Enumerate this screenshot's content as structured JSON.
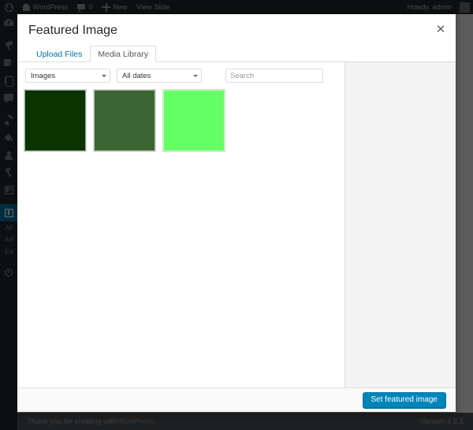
{
  "adminbar": {
    "logo_icon": "wordpress-logo-icon",
    "site_name": "WordPress",
    "site_icon": "home-icon",
    "comments_icon": "comment-bubble-icon",
    "comments_count": "0",
    "new_icon": "plus-icon",
    "new_label": "New",
    "view_label": "View Slide",
    "howdy": "Howdy, admin"
  },
  "adminmenu": {
    "items": [
      {
        "name": "dashboard",
        "icon": "dashboard-icon"
      },
      {
        "name": "posts",
        "icon": "pushpin-icon"
      },
      {
        "name": "media",
        "icon": "media-photo-icon"
      },
      {
        "name": "pages",
        "icon": "pages-document-icon"
      },
      {
        "name": "comments",
        "icon": "comment-bubble-icon"
      },
      {
        "name": "appearance",
        "icon": "paintbrush-icon"
      },
      {
        "name": "plugins",
        "icon": "plug-icon"
      },
      {
        "name": "users",
        "icon": "user-icon"
      },
      {
        "name": "tools",
        "icon": "wrench-icon"
      },
      {
        "name": "settings",
        "icon": "settings-sliders-icon"
      }
    ],
    "current": {
      "name": "slides",
      "icon": "slides-icon"
    },
    "submenu": [
      {
        "label": "All"
      },
      {
        "label": "Ad"
      },
      {
        "label": "Ea"
      }
    ],
    "collapse": {
      "label": "",
      "icon": "collapse-arrow-icon"
    }
  },
  "modal": {
    "title": "Featured Image",
    "close_icon": "close-icon",
    "tabs": [
      {
        "label": "Upload Files",
        "active": false
      },
      {
        "label": "Media Library",
        "active": true
      }
    ],
    "toolbar": {
      "type_filter": {
        "value": "Images",
        "caret_icon": "chevron-down-icon"
      },
      "date_filter": {
        "value": "All dates",
        "caret_icon": "chevron-down-icon"
      },
      "search": {
        "value": "",
        "placeholder": "Search"
      }
    },
    "attachments": [
      {
        "name": "attachment-1",
        "color": "#0b3300"
      },
      {
        "name": "attachment-2",
        "color": "#3b6633"
      },
      {
        "name": "attachment-3",
        "color": "#66ff66"
      }
    ],
    "footer": {
      "primary_button": "Set featured image"
    }
  },
  "page_footer": {
    "thanks_prefix": "Thank you for creating with ",
    "wordpress_link": "WordPress",
    "thanks_suffix": ".",
    "version": "Version 4.5.1"
  },
  "colors": {
    "admin_chrome": "#23282d",
    "accent_blue": "#0085ba",
    "link_blue": "#0073aa",
    "sidebar_panel": "#f3f3f3"
  }
}
